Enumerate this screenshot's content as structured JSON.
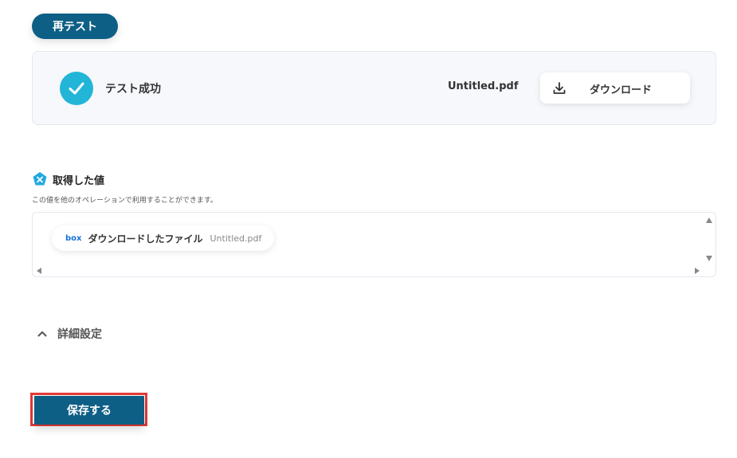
{
  "retest": {
    "label": "再テスト"
  },
  "result": {
    "status_text": "テスト成功",
    "file_name": "Untitled.pdf",
    "download_label": "ダウンロード"
  },
  "acquired": {
    "title": "取得した値",
    "description": "この値を他のオペレーションで利用することができます。",
    "items": [
      {
        "service": "box",
        "label": "ダウンロードしたファイル",
        "value": "Untitled.pdf"
      }
    ]
  },
  "advanced": {
    "label": "詳細設定"
  },
  "save": {
    "label": "保存する"
  },
  "colors": {
    "primary": "#0e5f85",
    "success": "#22b5d8",
    "highlight": "#e53935",
    "box_brand": "#1a73d9"
  }
}
